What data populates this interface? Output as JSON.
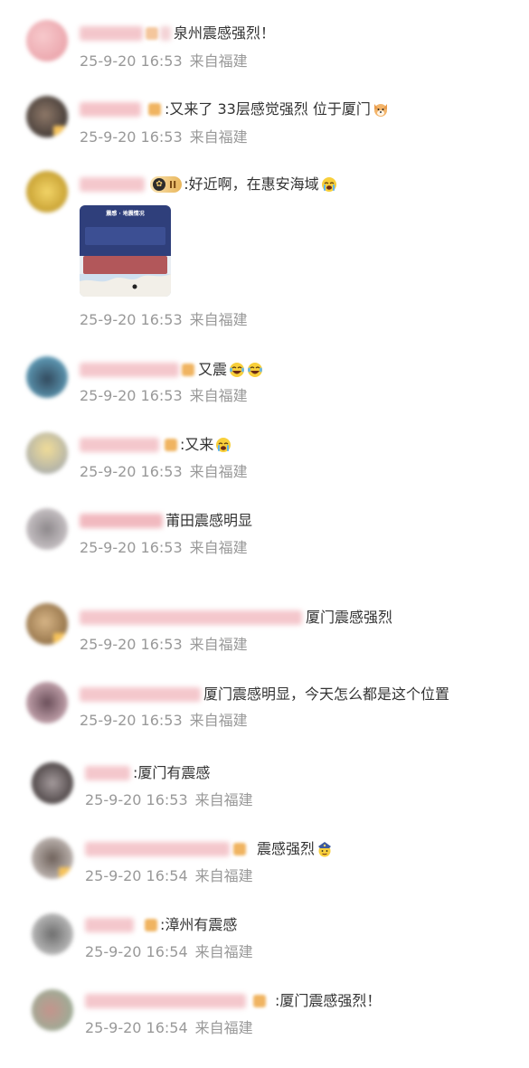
{
  "comments": [
    {
      "text": "泉州震感强烈！",
      "time": "25-9-20 16:53",
      "source": "来自福建",
      "avatar_colors": [
        "#f3b8bb",
        "#e7a2a8"
      ],
      "name_colors": [
        "#f3c6cb",
        "#e7b6bd"
      ],
      "badge": false
    },
    {
      "text": ":又来了 33层感觉强烈 位于厦门",
      "time": "25-9-20 16:53",
      "source": "来自福建",
      "avatar_colors": [
        "#2e2a2a",
        "#7d6a5b"
      ],
      "name_colors": [
        "#f4c7cc",
        "#edb6bd"
      ],
      "badge": true,
      "emoji": "dog-face-icon"
    },
    {
      "text": ":好近啊，在惠安海域",
      "time": "25-9-20 16:53",
      "source": "来自福建",
      "avatar_colors": [
        "#e3c042",
        "#b99524"
      ],
      "name_colors": [
        "#f4c7cc",
        "#edb6bd"
      ],
      "badge": false,
      "vip_label": "II",
      "emoji": "crying-face-icon",
      "image": {
        "title": "震感 · 地震情况",
        "kind": "earthquake-map"
      }
    },
    {
      "text": "又震",
      "time": "25-9-20 16:53",
      "source": "来自福建",
      "avatar_colors": [
        "#6fb1cf",
        "#2a4257"
      ],
      "name_colors": [
        "#f4c7cc",
        "#edb6bd"
      ],
      "badge": false,
      "emoji": "laughing-face-icon",
      "emoji2": "laughing-face-icon"
    },
    {
      "text": ":又来",
      "time": "25-9-20 16:53",
      "source": "来自福建",
      "avatar_colors": [
        "#e8d08a",
        "#9aa4b2"
      ],
      "name_colors": [
        "#f4c7cc",
        "#edb6bd"
      ],
      "badge": false,
      "emoji": "crying-face-icon"
    },
    {
      "text": "莆田震感明显",
      "time": "25-9-20 16:53",
      "source": "来自福建",
      "avatar_colors": [
        "#d7d1d4",
        "#8f8a8d"
      ],
      "name_colors": [
        "#f3bdc3",
        "#e9aab1"
      ],
      "badge": false
    },
    {
      "text": "厦门震感强烈",
      "time": "25-9-20 16:53",
      "source": "来自福建",
      "avatar_colors": [
        "#8c6a3f",
        "#d2b083"
      ],
      "name_colors": [
        "#f4c7cc",
        "#edb6bd"
      ],
      "badge": true
    },
    {
      "text": "厦门震感明显，今天怎么都是这个位置",
      "time": "25-9-20 16:53",
      "source": "来自福建",
      "avatar_colors": [
        "#c79aa5",
        "#6b4f5a"
      ],
      "name_colors": [
        "#f4c7cc",
        "#edb6bd"
      ],
      "badge": false
    },
    {
      "text": ":厦门有震感",
      "time": "25-9-20 16:53",
      "source": "来自福建",
      "avatar_colors": [
        "#3a3233",
        "#9a9093"
      ],
      "name_colors": [
        "#f4c7cc",
        "#edb6bd"
      ],
      "badge": false
    },
    {
      "text": "震感强烈",
      "time": "25-9-20 16:54",
      "source": "来自福建",
      "avatar_colors": [
        "#7a6b63",
        "#d8d2cf"
      ],
      "name_colors": [
        "#f4c7cc",
        "#edb6bd"
      ],
      "badge": true,
      "emoji": "police-face-icon"
    },
    {
      "text": ":漳州有震感",
      "time": "25-9-20 16:54",
      "source": "来自福建",
      "avatar_colors": [
        "#c7c7c7",
        "#6e6e6e"
      ],
      "name_colors": [
        "#f4c7cc",
        "#edb6bd"
      ],
      "badge": false
    },
    {
      "text": ":厦门震感强烈！",
      "time": "25-9-20 16:54",
      "source": "来自福建",
      "avatar_colors": [
        "#8fb59a",
        "#c4948c"
      ],
      "name_colors": [
        "#f4c7cc",
        "#edb6bd"
      ],
      "badge": false
    }
  ]
}
